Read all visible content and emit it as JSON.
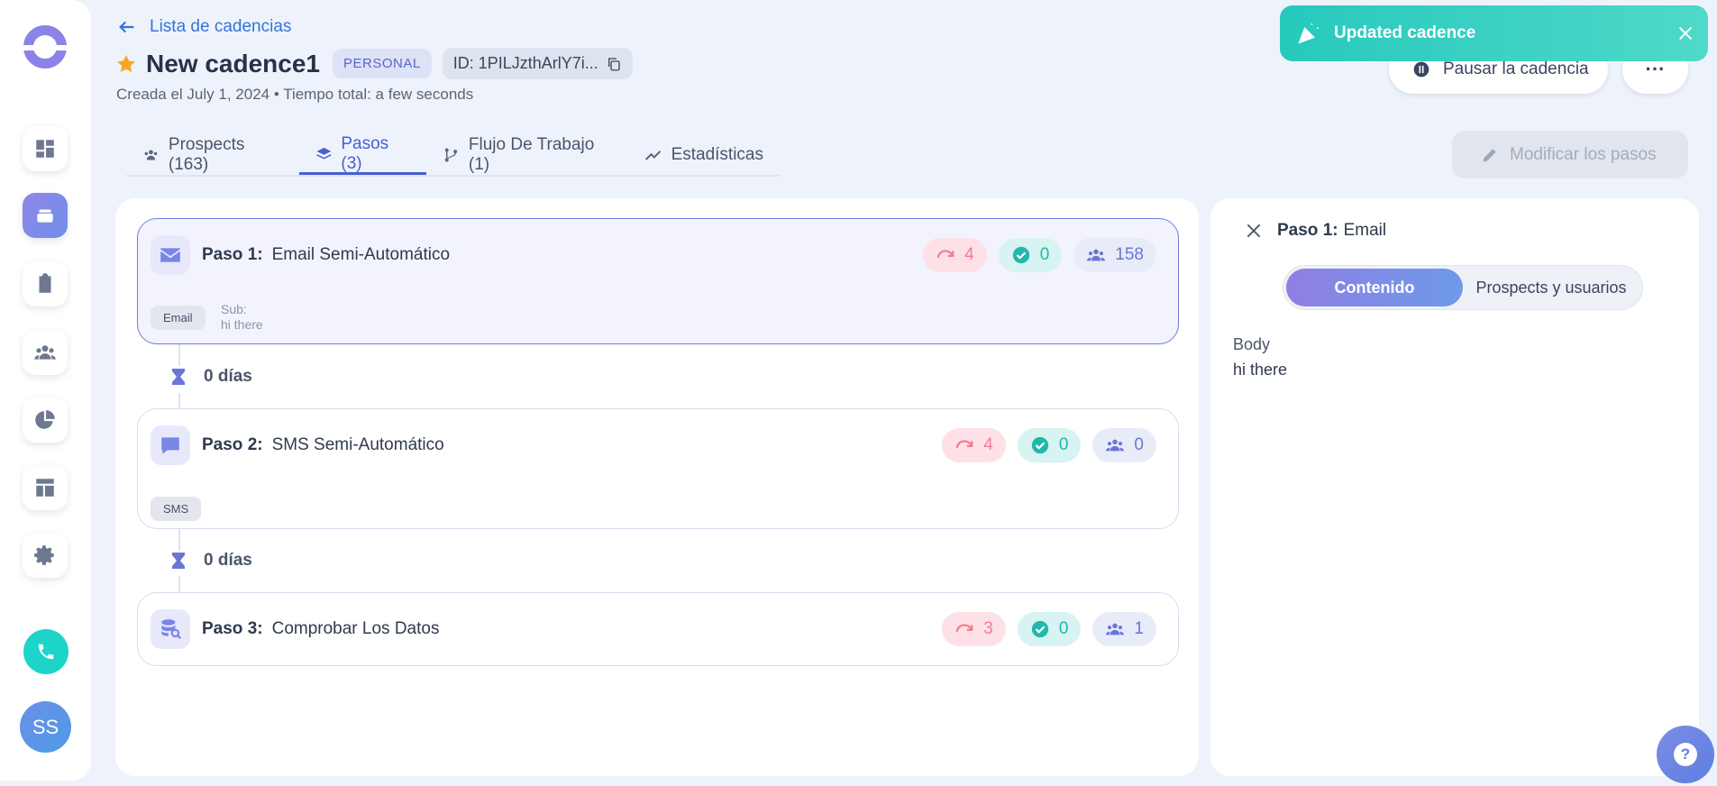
{
  "sidebar": {
    "items": [
      {
        "icon": "dashboard-icon"
      },
      {
        "icon": "cadences-icon",
        "active": true
      },
      {
        "icon": "clipboard-icon"
      },
      {
        "icon": "people-icon"
      },
      {
        "icon": "pie-chart-icon"
      },
      {
        "icon": "layout-icon"
      },
      {
        "icon": "gear-icon"
      }
    ],
    "avatar_initials": "SS"
  },
  "header": {
    "back_label": "Lista de cadencias",
    "title": "New cadence1",
    "badge": "PERSONAL",
    "id_label": "ID: 1PILJzthArlY7i...",
    "created": "Creada el July 1, 2024 • Tiempo total: a few seconds",
    "pause_label": "Pausar la cadencia",
    "more_label": "···"
  },
  "toast": {
    "message": "Updated cadence",
    "color": "#2ccabd"
  },
  "tabs": [
    {
      "label": "Prospects (163)",
      "icon": "people-icon"
    },
    {
      "label": "Pasos (3)",
      "icon": "layers-icon",
      "active": true
    },
    {
      "label": "Flujo De Trabajo (1)",
      "icon": "branch-icon"
    },
    {
      "label": "Estadísticas",
      "icon": "trend-icon"
    }
  ],
  "modify_label": "Modificar los pasos",
  "steps": [
    {
      "prefix": "Paso 1:",
      "name": "Email Semi-Automático",
      "skipped": "4",
      "done": "0",
      "prospects": "158",
      "tag": "Email",
      "sub_label": "Sub:",
      "sub_text": "hi there",
      "selected": true
    },
    {
      "prefix": "Paso 2:",
      "name": "SMS Semi-Automático",
      "skipped": "4",
      "done": "0",
      "prospects": "0",
      "tag": "SMS"
    },
    {
      "prefix": "Paso 3:",
      "name": "Comprobar Los Datos",
      "skipped": "3",
      "done": "0",
      "prospects": "1"
    }
  ],
  "delays": [
    "0 días",
    "0 días"
  ],
  "detail": {
    "prefix": "Paso 1:",
    "name": "Email",
    "toggle_on": "Contenido",
    "toggle_off": "Prospects y usuarios",
    "body_label": "Body",
    "body_text": "hi there"
  },
  "colors": {
    "accent": "#4660d0",
    "brand": "#8b83e6",
    "success": "#21b8ab",
    "danger": "#f07d91"
  }
}
